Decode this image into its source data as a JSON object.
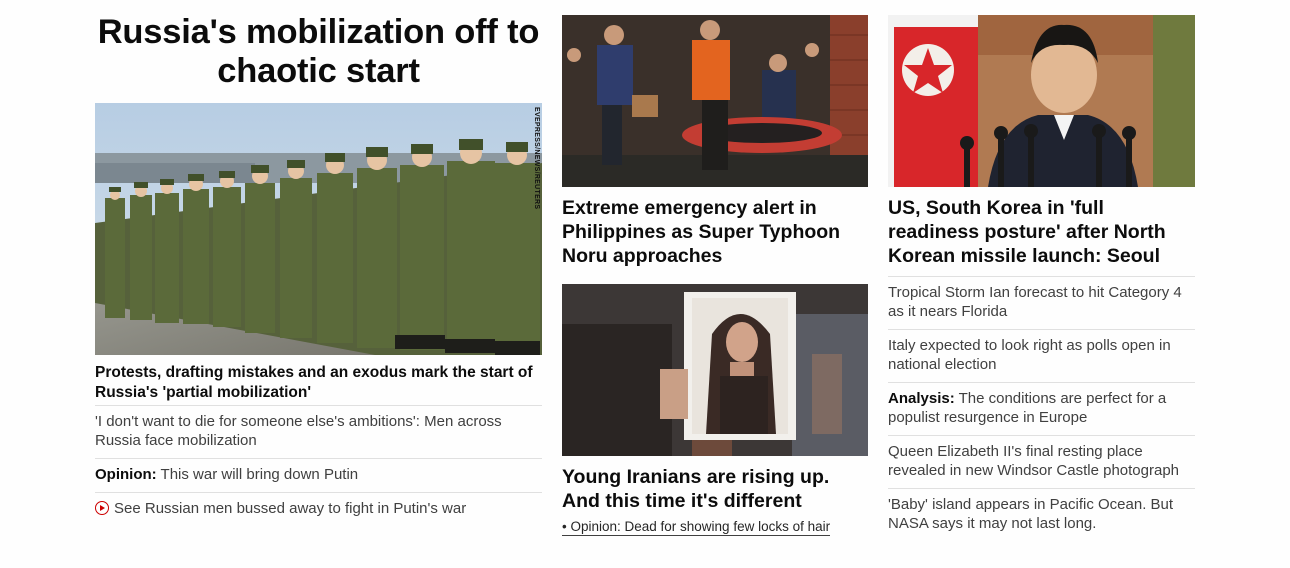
{
  "lead": {
    "headline": "Russia's mobilization off to chaotic start",
    "photo_alt": "Russian conscripts standing in formation",
    "photo_credit": "EVEPRESS/NEWS/REUTERS",
    "subheadline": "Protests, drafting mistakes and an exodus mark the start of Russia's 'partial mobilization'",
    "links": [
      {
        "tag": "",
        "text": "'I don't want to die for someone else's ambitions': Men across Russia face mobilization"
      },
      {
        "tag": "Opinion:",
        "text": " This war will bring down Putin"
      },
      {
        "tag": "",
        "text": "See Russian men bussed away to fight in Putin's war",
        "icon": "play-video-icon"
      }
    ]
  },
  "middle": {
    "story1": {
      "photo_alt": "Rescue workers carrying an inflatable boat",
      "headline": "Extreme emergency alert in Philippines as Super Typhoon Noru approaches"
    },
    "story2": {
      "photo_alt": "Protester holding a photo of a woman",
      "headline": "Young Iranians are rising up. And this time it's different",
      "sublink": "• Opinion: Dead for showing few locks of hair"
    }
  },
  "right": {
    "photo_alt": "Kim Jong Un speaking at microphones",
    "headline": "US, South Korea in 'full readiness posture' after North Korean missile launch: Seoul",
    "links": [
      {
        "tag": "",
        "text": "Tropical Storm Ian forecast to hit Category 4 as it nears Florida"
      },
      {
        "tag": "",
        "text": "Italy expected to look right as polls open in national election"
      },
      {
        "tag": "Analysis:",
        "text": " The conditions are perfect for a populist resurgence in Europe"
      },
      {
        "tag": "",
        "text": "Queen Elizabeth II's final resting place revealed in new Windsor Castle photograph"
      },
      {
        "tag": "",
        "text": "'Baby' island appears in Pacific Ocean. But NASA says it may not last long."
      }
    ]
  },
  "colors": {
    "text": "#0c0c0c",
    "link_text": "#404040",
    "divider": "#e0e0e0",
    "video_icon": "#cc0000"
  }
}
